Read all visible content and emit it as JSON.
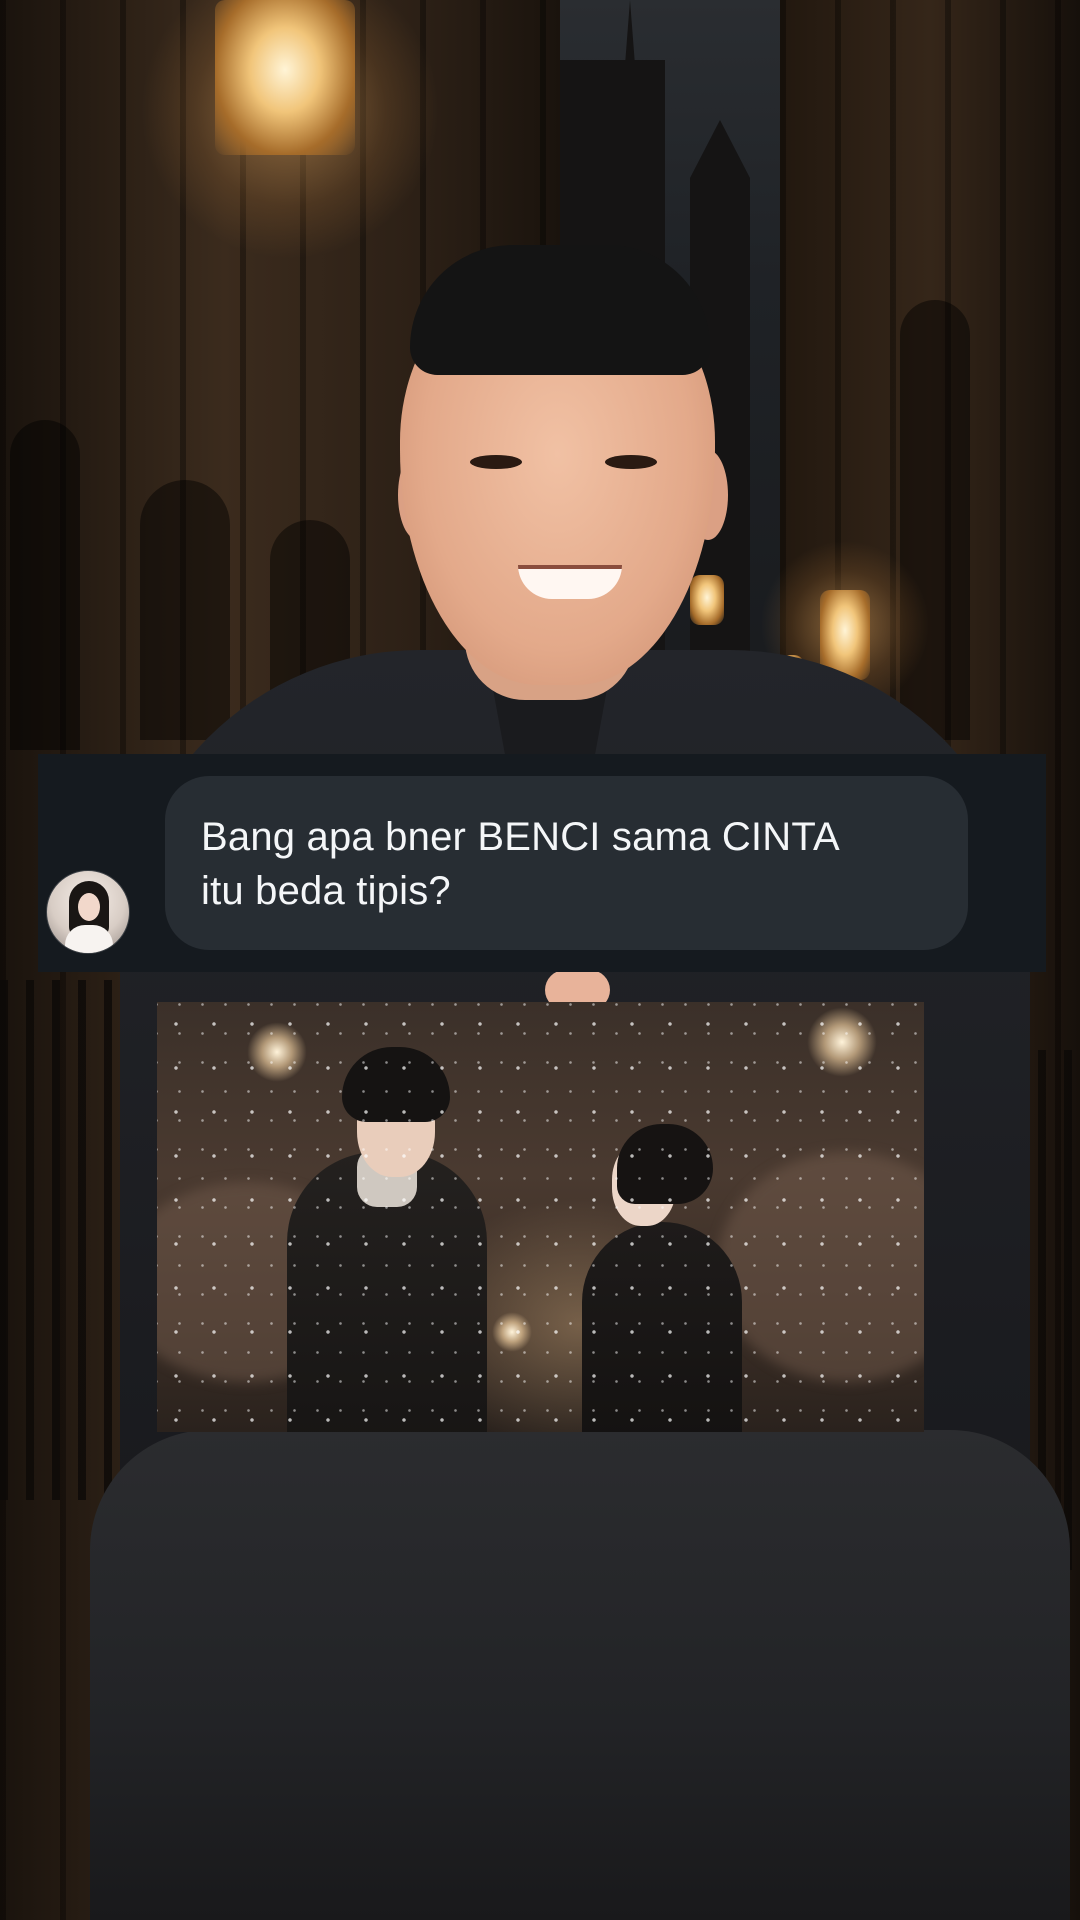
{
  "chat": {
    "question_text": "Bang apa bner BENCI sama CINTA\nitu beda tipis?",
    "avatar_icon": "user-avatar-icon"
  },
  "colors": {
    "chat_panel_bg": "#151a1f",
    "bubble_bg": "#272d33",
    "bubble_text": "#f4f6f8"
  }
}
